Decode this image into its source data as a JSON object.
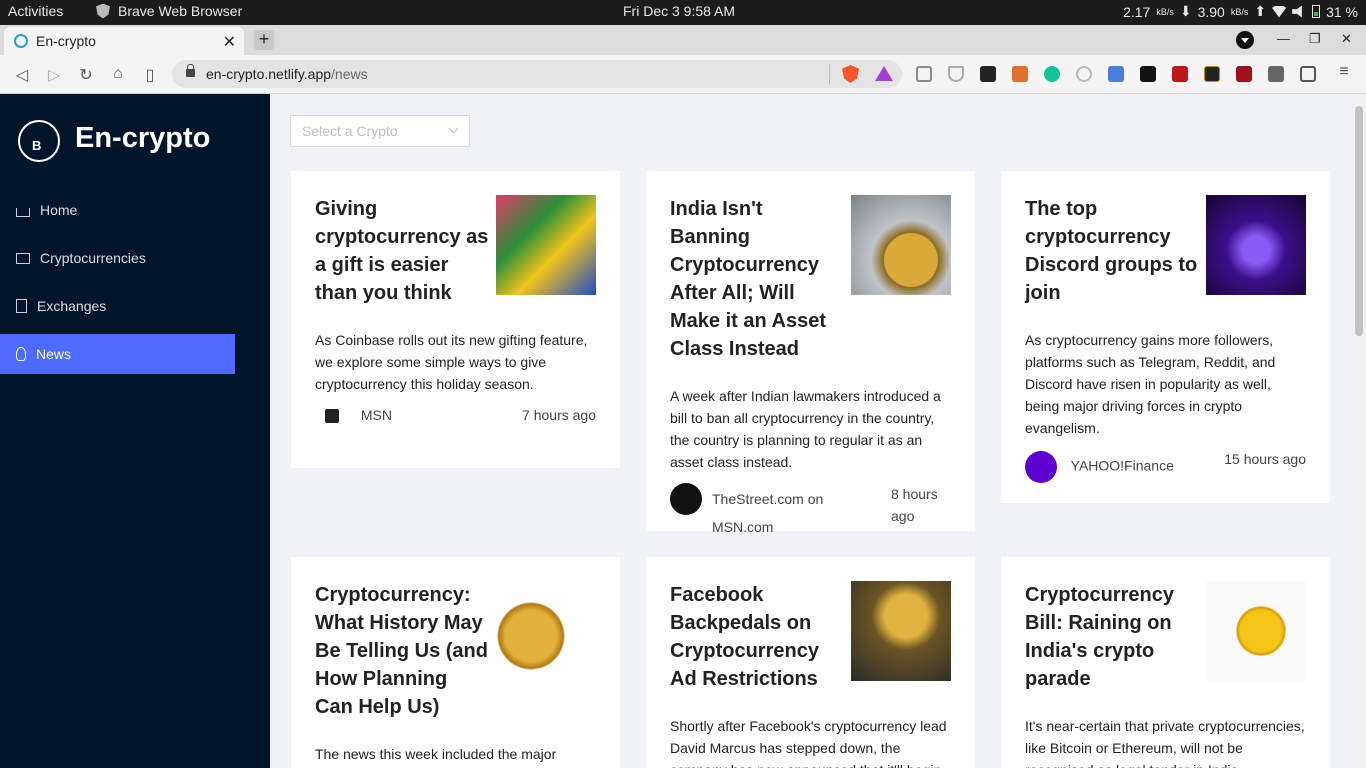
{
  "os": {
    "activities": "Activities",
    "app_name": "Brave Web Browser",
    "clock": "Fri Dec 3   9:58 AM",
    "net_down": "2.17",
    "net_down_unit": "kB/s",
    "net_up": "3.90",
    "net_up_unit": "kB/s",
    "battery": "31 %"
  },
  "browser": {
    "tab_title": "En-crypto",
    "url_host": "en-crypto.netlify.app",
    "url_path": "/news"
  },
  "sidebar": {
    "brand": "En-crypto",
    "items": [
      {
        "label": "Home",
        "icon": "home-icon"
      },
      {
        "label": "Cryptocurrencies",
        "icon": "fund-icon"
      },
      {
        "label": "Exchanges",
        "icon": "money-collect-icon"
      },
      {
        "label": "News",
        "icon": "bulb-icon",
        "active": true
      }
    ]
  },
  "main": {
    "select_placeholder": "Select a Crypto",
    "cards": [
      {
        "title": "Giving cryptocurrency as a gift is easier than you think",
        "desc": "As Coinbase rolls out its new gifting feature, we explore some simple ways to give cryptocurrency this holiday season.",
        "provider": "MSN",
        "time": "7 hours ago"
      },
      {
        "title": "India Isn't Banning Cryptocurrency After All; Will Make it an Asset Class Instead",
        "desc": "A week after Indian lawmakers introduced a bill to ban all cryptocurrency in the country, the country is planning to regular it as an asset class instead.",
        "provider": "TheStreet.com on MSN.com",
        "time": "8 hours ago"
      },
      {
        "title": "The top cryptocurrency Discord groups to join",
        "desc": "As cryptocurrency gains more followers, platforms such as Telegram, Reddit, and Discord have risen in popularity as well, being major driving forces in crypto evangelism.",
        "provider": "YAHOO!Finance",
        "time": "15 hours ago"
      },
      {
        "title": "Cryptocurrency: What History May Be Telling Us (and How Planning Can Help Us)",
        "desc": "The news this week included the major",
        "provider": "",
        "time": ""
      },
      {
        "title": "Facebook Backpedals on Cryptocurrency Ad Restrictions",
        "desc": "Shortly after Facebook's cryptocurrency lead David Marcus has stepped down, the company has now announced that it'll begin",
        "provider": "",
        "time": ""
      },
      {
        "title": "Cryptocurrency Bill: Raining on India's crypto parade",
        "desc": "It's near-certain that private cryptocurrencies, like Bitcoin or Ethereum, will not be recognised as legal tender in India",
        "provider": "",
        "time": ""
      }
    ]
  }
}
